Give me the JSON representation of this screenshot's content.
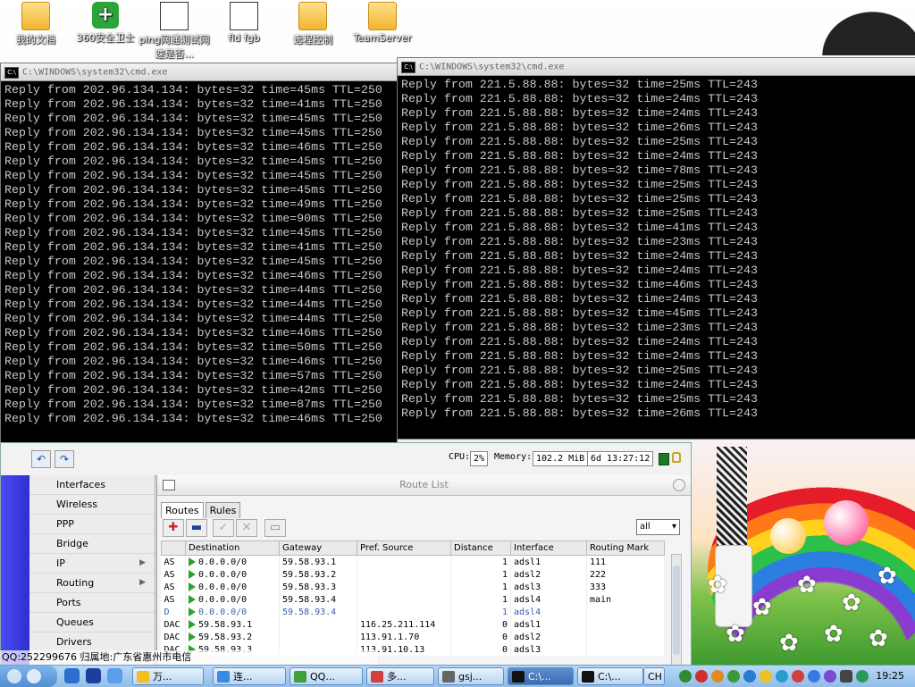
{
  "desktop": {
    "icons": [
      {
        "label": "我的文档",
        "kind": "folder"
      },
      {
        "label": "360安全卫士",
        "kind": "shield"
      },
      {
        "label": "ping网通测试网速是否...",
        "kind": "app"
      },
      {
        "label": "fld fgb",
        "kind": "doc"
      },
      {
        "label": "远程控制",
        "kind": "folder"
      },
      {
        "label": "TeamServer",
        "kind": "folder"
      }
    ]
  },
  "cmd_left": {
    "title": "C:\\WINDOWS\\system32\\cmd.exe",
    "lines": [
      "Reply from 202.96.134.134: bytes=32 time=45ms TTL=250",
      "Reply from 202.96.134.134: bytes=32 time=41ms TTL=250",
      "Reply from 202.96.134.134: bytes=32 time=45ms TTL=250",
      "Reply from 202.96.134.134: bytes=32 time=45ms TTL=250",
      "Reply from 202.96.134.134: bytes=32 time=46ms TTL=250",
      "Reply from 202.96.134.134: bytes=32 time=45ms TTL=250",
      "Reply from 202.96.134.134: bytes=32 time=45ms TTL=250",
      "Reply from 202.96.134.134: bytes=32 time=45ms TTL=250",
      "Reply from 202.96.134.134: bytes=32 time=49ms TTL=250",
      "Reply from 202.96.134.134: bytes=32 time=90ms TTL=250",
      "Reply from 202.96.134.134: bytes=32 time=45ms TTL=250",
      "Reply from 202.96.134.134: bytes=32 time=41ms TTL=250",
      "Reply from 202.96.134.134: bytes=32 time=45ms TTL=250",
      "Reply from 202.96.134.134: bytes=32 time=46ms TTL=250",
      "Reply from 202.96.134.134: bytes=32 time=44ms TTL=250",
      "Reply from 202.96.134.134: bytes=32 time=44ms TTL=250",
      "Reply from 202.96.134.134: bytes=32 time=44ms TTL=250",
      "Reply from 202.96.134.134: bytes=32 time=46ms TTL=250",
      "Reply from 202.96.134.134: bytes=32 time=50ms TTL=250",
      "Reply from 202.96.134.134: bytes=32 time=46ms TTL=250",
      "Reply from 202.96.134.134: bytes=32 time=57ms TTL=250",
      "Reply from 202.96.134.134: bytes=32 time=42ms TTL=250",
      "Reply from 202.96.134.134: bytes=32 time=87ms TTL=250",
      "Reply from 202.96.134.134: bytes=32 time=46ms TTL=250"
    ]
  },
  "cmd_right": {
    "title": "C:\\WINDOWS\\system32\\cmd.exe",
    "lines": [
      "Reply from 221.5.88.88: bytes=32 time=25ms TTL=243",
      "Reply from 221.5.88.88: bytes=32 time=24ms TTL=243",
      "Reply from 221.5.88.88: bytes=32 time=24ms TTL=243",
      "Reply from 221.5.88.88: bytes=32 time=26ms TTL=243",
      "Reply from 221.5.88.88: bytes=32 time=25ms TTL=243",
      "Reply from 221.5.88.88: bytes=32 time=24ms TTL=243",
      "Reply from 221.5.88.88: bytes=32 time=78ms TTL=243",
      "Reply from 221.5.88.88: bytes=32 time=25ms TTL=243",
      "Reply from 221.5.88.88: bytes=32 time=25ms TTL=243",
      "Reply from 221.5.88.88: bytes=32 time=25ms TTL=243",
      "Reply from 221.5.88.88: bytes=32 time=41ms TTL=243",
      "Reply from 221.5.88.88: bytes=32 time=23ms TTL=243",
      "Reply from 221.5.88.88: bytes=32 time=24ms TTL=243",
      "Reply from 221.5.88.88: bytes=32 time=24ms TTL=243",
      "Reply from 221.5.88.88: bytes=32 time=46ms TTL=243",
      "Reply from 221.5.88.88: bytes=32 time=24ms TTL=243",
      "Reply from 221.5.88.88: bytes=32 time=45ms TTL=243",
      "Reply from 221.5.88.88: bytes=32 time=23ms TTL=243",
      "Reply from 221.5.88.88: bytes=32 time=24ms TTL=243",
      "Reply from 221.5.88.88: bytes=32 time=24ms TTL=243",
      "Reply from 221.5.88.88: bytes=32 time=25ms TTL=243",
      "Reply from 221.5.88.88: bytes=32 time=24ms TTL=243",
      "Reply from 221.5.88.88: bytes=32 time=25ms TTL=243",
      "Reply from 221.5.88.88: bytes=32 time=26ms TTL=243"
    ]
  },
  "winbox": {
    "status": {
      "cpu_label": "CPU:",
      "cpu_value": "2%",
      "memory_label": "Memory:",
      "memory_value": "102.2 MiB",
      "uptime": "6d 13:27:12"
    },
    "menu": [
      {
        "label": "Interfaces",
        "submenu": false
      },
      {
        "label": "Wireless",
        "submenu": false
      },
      {
        "label": "PPP",
        "submenu": false
      },
      {
        "label": "Bridge",
        "submenu": false
      },
      {
        "label": "IP",
        "submenu": true
      },
      {
        "label": "Routing",
        "submenu": true
      },
      {
        "label": "Ports",
        "submenu": false
      },
      {
        "label": "Queues",
        "submenu": false
      },
      {
        "label": "Drivers",
        "submenu": false
      }
    ],
    "route_list": {
      "title": "Route List",
      "tabs": [
        "Routes",
        "Rules"
      ],
      "filter_value": "all",
      "columns": [
        "",
        "Destination",
        "Gateway",
        "Pref. Source",
        "Distance",
        "Interface",
        "Routing Mark"
      ],
      "rows": [
        {
          "flag": "AS",
          "dest": "0.0.0.0/0",
          "gateway": "59.58.93.1",
          "pref_source": "",
          "distance": "1",
          "interface": "adsl1",
          "mark": "111",
          "dim": false
        },
        {
          "flag": "AS",
          "dest": "0.0.0.0/0",
          "gateway": "59.58.93.2",
          "pref_source": "",
          "distance": "1",
          "interface": "adsl2",
          "mark": "222",
          "dim": false
        },
        {
          "flag": "AS",
          "dest": "0.0.0.0/0",
          "gateway": "59.58.93.3",
          "pref_source": "",
          "distance": "1",
          "interface": "adsl3",
          "mark": "333",
          "dim": false
        },
        {
          "flag": "AS",
          "dest": "0.0.0.0/0",
          "gateway": "59.58.93.4",
          "pref_source": "",
          "distance": "1",
          "interface": "adsl4",
          "mark": "main",
          "dim": false
        },
        {
          "flag": "D",
          "dest": "0.0.0.0/0",
          "gateway": "59.58.93.4",
          "pref_source": "",
          "distance": "1",
          "interface": "adsl4",
          "mark": "",
          "dim": true
        },
        {
          "flag": "DAC",
          "dest": "59.58.93.1",
          "gateway": "",
          "pref_source": "116.25.211.114",
          "distance": "0",
          "interface": "adsl1",
          "mark": "",
          "dim": false
        },
        {
          "flag": "DAC",
          "dest": "59.58.93.2",
          "gateway": "",
          "pref_source": "113.91.1.70",
          "distance": "0",
          "interface": "adsl2",
          "mark": "",
          "dim": false
        },
        {
          "flag": "DAC",
          "dest": "59.58.93.3",
          "gateway": "",
          "pref_source": "113.91.10.13",
          "distance": "0",
          "interface": "adsl3",
          "mark": "",
          "dim": false
        }
      ]
    }
  },
  "qq_status": "QQ:252299676 归属地:广东省惠州市电信",
  "taskbar": {
    "tasks": [
      {
        "label": "万...",
        "active": false
      },
      {
        "label": "连...",
        "active": false
      },
      {
        "label": "QQ...",
        "active": false
      },
      {
        "label": "多...",
        "active": false
      },
      {
        "label": "gsj...",
        "active": false
      },
      {
        "label": "C:\\...",
        "active": true
      },
      {
        "label": "C:\\...",
        "active": false
      }
    ],
    "ime": "CH",
    "clock": "19:25"
  },
  "colors": {
    "cmd_text": "#c8c8c8",
    "winbox_sidebar": "#3b3be0",
    "taskbar": "#9cc6ee"
  }
}
